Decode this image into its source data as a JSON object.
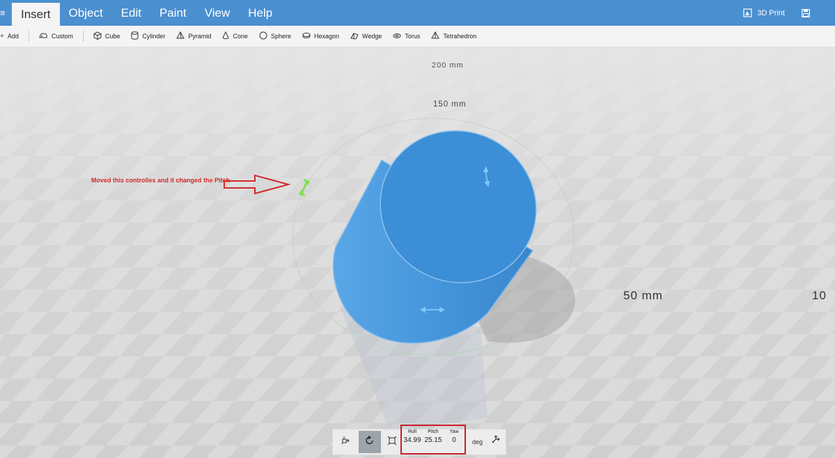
{
  "menu": {
    "hamburger": "≡",
    "tabs": [
      "Insert",
      "Object",
      "Edit",
      "Paint",
      "View",
      "Help"
    ],
    "active_tab": "Insert",
    "print_label": "3D Print"
  },
  "toolbar": {
    "add_label": "Add",
    "custom_label": "Custom",
    "shapes": [
      "Cube",
      "Cylinder",
      "Pyramid",
      "Cone",
      "Sphere",
      "Hexagon",
      "Wedge",
      "Torus",
      "Tetrahedron"
    ]
  },
  "viewport": {
    "rulers": [
      "200 mm",
      "150 mm",
      "50 mm",
      "10"
    ],
    "annotation": "Moved this controlles and it changed the Pitch"
  },
  "transform": {
    "roll_label": "Roll",
    "pitch_label": "Pitch",
    "yaw_label": "Yaw",
    "roll": "34.99",
    "pitch": "25.15",
    "yaw": "0",
    "unit": "deg"
  },
  "colors": {
    "menubar": "#4a8fd0",
    "object": "#3f8fd8",
    "annotation": "#d22a2a"
  }
}
